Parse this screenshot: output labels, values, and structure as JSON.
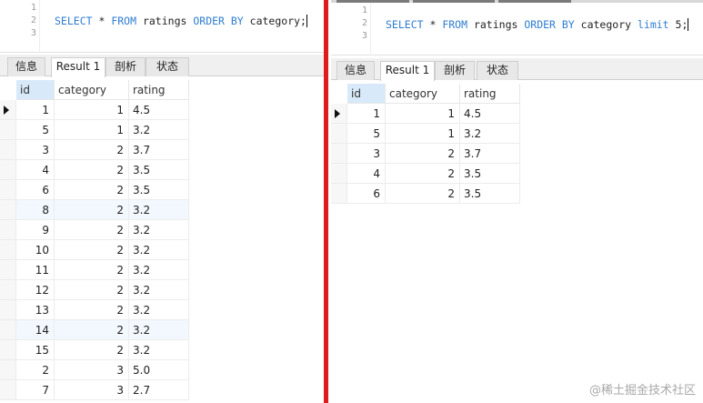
{
  "query_tabs": {
    "result_label": "Result 1",
    "info_label": "信息",
    "profile_label": "剖析",
    "status_label": "状态"
  },
  "left": {
    "editor": {
      "lines": [
        "1",
        "2",
        "3"
      ],
      "sql": {
        "select": "SELECT",
        "star": " * ",
        "from": "FROM",
        "table": " ratings ",
        "order_by": "ORDER BY",
        "column": " category;"
      }
    },
    "grid": {
      "columns": [
        "id",
        "category",
        "rating"
      ],
      "rows": [
        [
          "1",
          "1",
          "4.5"
        ],
        [
          "5",
          "1",
          "3.2"
        ],
        [
          "3",
          "2",
          "3.7"
        ],
        [
          "4",
          "2",
          "3.5"
        ],
        [
          "6",
          "2",
          "3.5"
        ],
        [
          "8",
          "2",
          "3.2"
        ],
        [
          "9",
          "2",
          "3.2"
        ],
        [
          "10",
          "2",
          "3.2"
        ],
        [
          "11",
          "2",
          "3.2"
        ],
        [
          "12",
          "2",
          "3.2"
        ],
        [
          "13",
          "2",
          "3.2"
        ],
        [
          "14",
          "2",
          "3.2"
        ],
        [
          "15",
          "2",
          "3.2"
        ],
        [
          "2",
          "3",
          "5.0"
        ],
        [
          "7",
          "3",
          "2.7"
        ]
      ]
    }
  },
  "right": {
    "editor": {
      "lines": [
        "1",
        "2",
        "3"
      ],
      "sql": {
        "select": "SELECT",
        "star": " * ",
        "from": "FROM",
        "table": " ratings ",
        "order_by": "ORDER BY",
        "column": " category ",
        "limit": "limit",
        "count": " 5;"
      }
    },
    "grid": {
      "columns": [
        "id",
        "category",
        "rating"
      ],
      "rows": [
        [
          "1",
          "1",
          "4.5"
        ],
        [
          "5",
          "1",
          "3.2"
        ],
        [
          "3",
          "2",
          "3.7"
        ],
        [
          "4",
          "2",
          "3.5"
        ],
        [
          "6",
          "2",
          "3.5"
        ]
      ]
    }
  },
  "watermark": "@稀土掘金技术社区",
  "colors": {
    "keyword": "#2f7dd1",
    "divider": "#e01b1b",
    "selected_header": "#d8eaf9",
    "highlight_row": "#f2f8fd"
  },
  "icons": {
    "row_pointer": "row-pointer-icon"
  }
}
